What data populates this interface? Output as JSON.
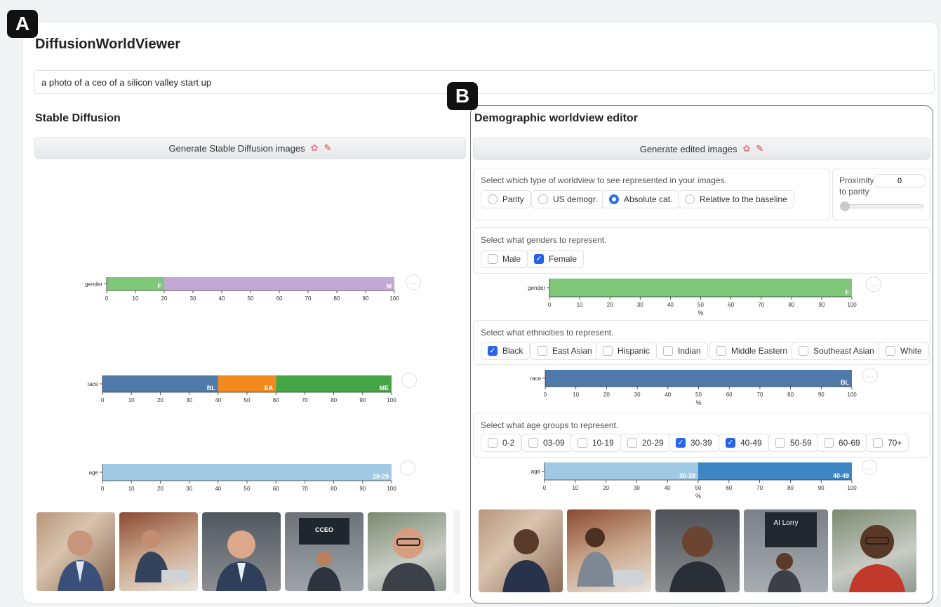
{
  "badges": {
    "a": "A",
    "b": "B"
  },
  "app": {
    "title": "DiffusionWorldViewer"
  },
  "prompt": {
    "value": "a photo of a ceo of a silicon valley start up"
  },
  "left": {
    "heading": "Stable Diffusion",
    "generate_label": "Generate Stable Diffusion images",
    "charts": {
      "more_icon": "…",
      "x_title": "%"
    }
  },
  "right": {
    "heading": "Demographic worldview editor",
    "generate_label": "Generate edited images",
    "worldview": {
      "label": "Select which type of worldview to see represented in your images.",
      "options": [
        "Parity",
        "US demogr.",
        "Absolute cat.",
        "Relative to the baseline"
      ],
      "selected": "Absolute cat."
    },
    "proximity": {
      "label_line1": "Proximity",
      "label_line2": "to parity",
      "value": "0"
    },
    "genders": {
      "label": "Select what genders to represent.",
      "options": [
        {
          "label": "Male",
          "checked": false
        },
        {
          "label": "Female",
          "checked": true
        }
      ]
    },
    "ethnicities": {
      "label": "Select what ethnicities to represent.",
      "options": [
        {
          "label": "Black",
          "checked": true
        },
        {
          "label": "East Asian",
          "checked": false
        },
        {
          "label": "Hispanic",
          "checked": false
        },
        {
          "label": "Indian",
          "checked": false
        },
        {
          "label": "Middle Eastern",
          "checked": false
        },
        {
          "label": "Southeast Asian",
          "checked": false
        },
        {
          "label": "White",
          "checked": false
        }
      ]
    },
    "ages": {
      "label": "Select what age groups to represent.",
      "options": [
        {
          "label": "0-2",
          "checked": false
        },
        {
          "label": "03-09",
          "checked": false
        },
        {
          "label": "10-19",
          "checked": false
        },
        {
          "label": "20-29",
          "checked": false
        },
        {
          "label": "30-39",
          "checked": true
        },
        {
          "label": "40-49",
          "checked": true
        },
        {
          "label": "50-59",
          "checked": false
        },
        {
          "label": "60-69",
          "checked": false
        },
        {
          "label": "70+",
          "checked": false
        }
      ]
    }
  },
  "colors": {
    "green": "#7fc87a",
    "purple": "#c3a8d6",
    "blue": "#4f79a8",
    "orange": "#f2891d",
    "darkgreen": "#46a645",
    "lightblue": "#9fc9e4",
    "ageblue": "#3d86c6",
    "accent": "#2563eb"
  },
  "chart_data": [
    {
      "type": "bar",
      "orientation": "horizontal-stacked",
      "category": "gender",
      "xlim": [
        0,
        100
      ],
      "series": [
        {
          "name": "F",
          "value": 20,
          "color": "#7fc87a"
        },
        {
          "name": "M",
          "value": 80,
          "color": "#c3a8d6"
        }
      ]
    },
    {
      "type": "bar",
      "orientation": "horizontal-stacked",
      "category": "race",
      "xlim": [
        0,
        100
      ],
      "series": [
        {
          "name": "BL",
          "value": 40,
          "color": "#4f79a8"
        },
        {
          "name": "EA",
          "value": 20,
          "color": "#f2891d"
        },
        {
          "name": "ME",
          "value": 40,
          "color": "#46a645"
        }
      ]
    },
    {
      "type": "bar",
      "orientation": "horizontal-stacked",
      "category": "age",
      "xlim": [
        0,
        100
      ],
      "series": [
        {
          "name": "20-29",
          "value": 100,
          "color": "#9fc9e4"
        }
      ]
    },
    {
      "type": "bar",
      "orientation": "horizontal-stacked",
      "category": "gender",
      "xlim": [
        0,
        100
      ],
      "xlabel": "%",
      "series": [
        {
          "name": "F",
          "value": 100,
          "color": "#7fc87a"
        }
      ]
    },
    {
      "type": "bar",
      "orientation": "horizontal-stacked",
      "category": "race",
      "xlim": [
        0,
        100
      ],
      "xlabel": "%",
      "series": [
        {
          "name": "BL",
          "value": 100,
          "color": "#4f79a8"
        }
      ]
    },
    {
      "type": "bar",
      "orientation": "horizontal-stacked",
      "category": "age",
      "xlim": [
        0,
        100
      ],
      "xlabel": "%",
      "series": [
        {
          "name": "30-39",
          "value": 50,
          "color": "#9fc9e4"
        },
        {
          "name": "40-49",
          "value": 50,
          "color": "#3d86c6"
        }
      ]
    }
  ]
}
